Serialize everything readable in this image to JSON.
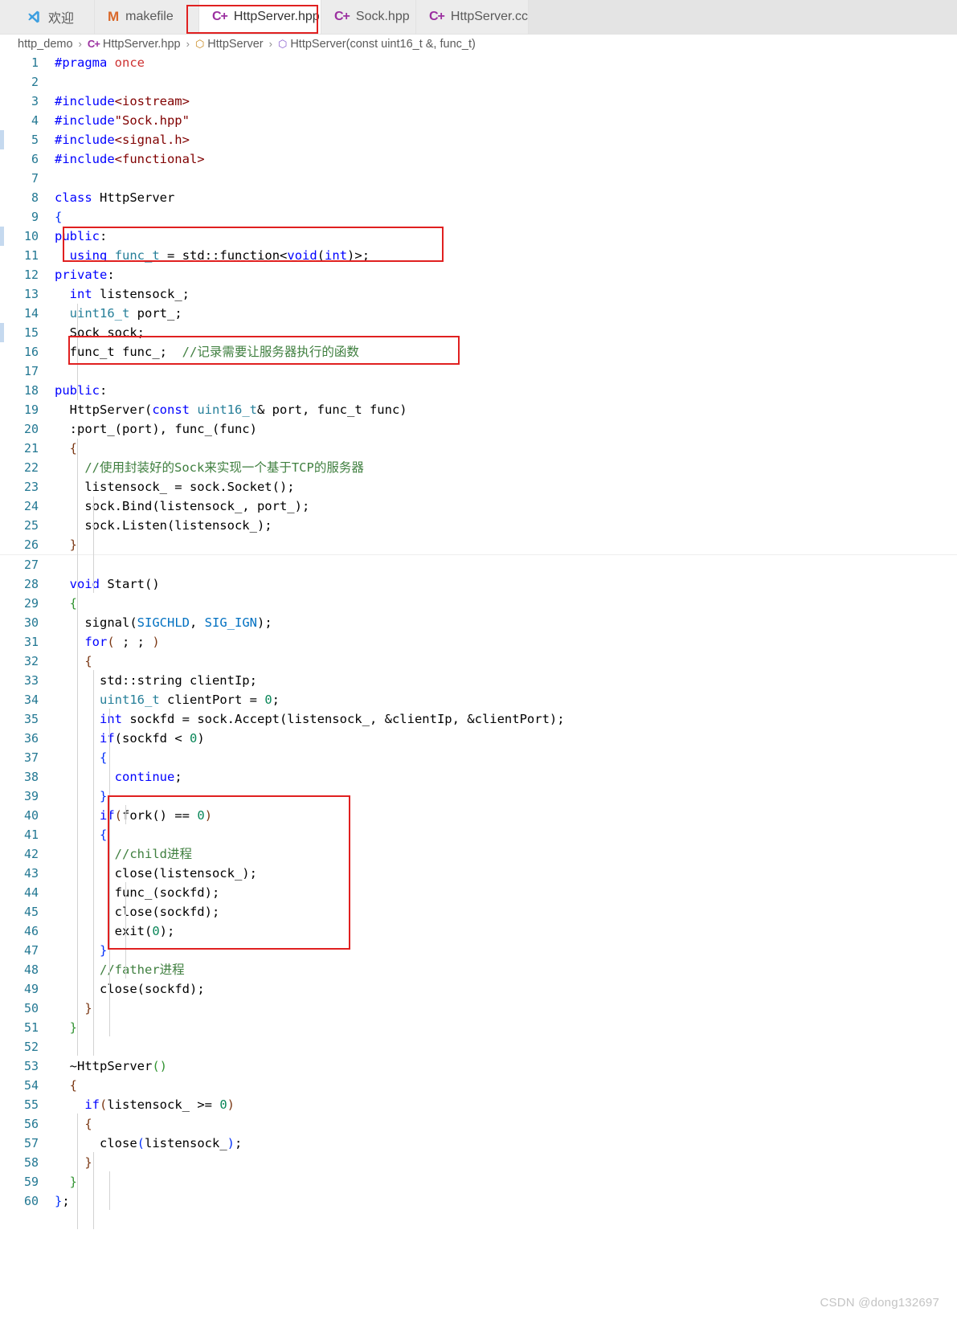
{
  "window": {
    "app": "Visual Studio Code",
    "active_file": "HttpServer.hpp"
  },
  "tabs": [
    {
      "label": "欢迎",
      "icon": "vscode-logo-icon",
      "active": false,
      "closable": false
    },
    {
      "label": "makefile",
      "icon": "makefile-icon",
      "active": false,
      "closable": false
    },
    {
      "label": "HttpServer.hpp",
      "icon": "cpp-file-icon",
      "active": true,
      "closable": true,
      "close_label": "✕"
    },
    {
      "label": "Sock.hpp",
      "icon": "cpp-file-icon",
      "active": false,
      "closable": false
    },
    {
      "label": "HttpServer.cc",
      "icon": "cpp-file-icon",
      "active": false,
      "closable": false
    }
  ],
  "breadcrumb": {
    "separator": "›",
    "items": [
      {
        "label": "http_demo",
        "icon": ""
      },
      {
        "label": "HttpServer.hpp",
        "icon": "cpp-file-icon"
      },
      {
        "label": "HttpServer",
        "icon": "class-icon"
      },
      {
        "label": "HttpServer(const uint16_t &, func_t)",
        "icon": "method-icon"
      }
    ]
  },
  "editor": {
    "language": "cpp",
    "first_line": 1,
    "last_line": 60,
    "lines": [
      {
        "n": 1,
        "text": "#pragma once"
      },
      {
        "n": 2,
        "text": ""
      },
      {
        "n": 3,
        "text": "#include<iostream>"
      },
      {
        "n": 4,
        "text": "#include\"Sock.hpp\""
      },
      {
        "n": 5,
        "text": "#include<signal.h>"
      },
      {
        "n": 6,
        "text": "#include<functional>"
      },
      {
        "n": 7,
        "text": ""
      },
      {
        "n": 8,
        "text": "class HttpServer"
      },
      {
        "n": 9,
        "text": "{"
      },
      {
        "n": 10,
        "text": "public:"
      },
      {
        "n": 11,
        "text": "  using func_t = std::function<void(int)>;"
      },
      {
        "n": 12,
        "text": "private:"
      },
      {
        "n": 13,
        "text": "  int listensock_;"
      },
      {
        "n": 14,
        "text": "  uint16_t port_;"
      },
      {
        "n": 15,
        "text": "  Sock sock;"
      },
      {
        "n": 16,
        "text": "  func_t func_;  //记录需要让服务器执行的函数"
      },
      {
        "n": 17,
        "text": ""
      },
      {
        "n": 18,
        "text": "public:"
      },
      {
        "n": 19,
        "text": "  HttpServer(const uint16_t& port, func_t func)"
      },
      {
        "n": 20,
        "text": "  :port_(port), func_(func)"
      },
      {
        "n": 21,
        "text": "  {"
      },
      {
        "n": 22,
        "text": "    //使用封装好的Sock来实现一个基于TCP的服务器"
      },
      {
        "n": 23,
        "text": "    listensock_ = sock.Socket();"
      },
      {
        "n": 24,
        "text": "    sock.Bind(listensock_, port_);"
      },
      {
        "n": 25,
        "text": "    sock.Listen(listensock_);"
      },
      {
        "n": 26,
        "text": "  }"
      },
      {
        "n": 27,
        "text": ""
      },
      {
        "n": 28,
        "text": "  void Start()"
      },
      {
        "n": 29,
        "text": "  {"
      },
      {
        "n": 30,
        "text": "    signal(SIGCHLD, SIG_IGN);"
      },
      {
        "n": 31,
        "text": "    for( ; ; )"
      },
      {
        "n": 32,
        "text": "    {"
      },
      {
        "n": 33,
        "text": "      std::string clientIp;"
      },
      {
        "n": 34,
        "text": "      uint16_t clientPort = 0;"
      },
      {
        "n": 35,
        "text": "      int sockfd = sock.Accept(listensock_, &clientIp, &clientPort);"
      },
      {
        "n": 36,
        "text": "      if(sockfd < 0)"
      },
      {
        "n": 37,
        "text": "      {"
      },
      {
        "n": 38,
        "text": "        continue;"
      },
      {
        "n": 39,
        "text": "      }"
      },
      {
        "n": 40,
        "text": "      if(fork() == 0)"
      },
      {
        "n": 41,
        "text": "      {"
      },
      {
        "n": 42,
        "text": "        //child进程"
      },
      {
        "n": 43,
        "text": "        close(listensock_);"
      },
      {
        "n": 44,
        "text": "        func_(sockfd);"
      },
      {
        "n": 45,
        "text": "        close(sockfd);"
      },
      {
        "n": 46,
        "text": "        exit(0);"
      },
      {
        "n": 47,
        "text": "      }"
      },
      {
        "n": 48,
        "text": "      //father进程"
      },
      {
        "n": 49,
        "text": "      close(sockfd);"
      },
      {
        "n": 50,
        "text": "    }"
      },
      {
        "n": 51,
        "text": "  }"
      },
      {
        "n": 52,
        "text": ""
      },
      {
        "n": 53,
        "text": "  ~HttpServer()"
      },
      {
        "n": 54,
        "text": "  {"
      },
      {
        "n": 55,
        "text": "    if(listensock_ >= 0)"
      },
      {
        "n": 56,
        "text": "    {"
      },
      {
        "n": 57,
        "text": "      close(listensock_);"
      },
      {
        "n": 58,
        "text": "    }"
      },
      {
        "n": 59,
        "text": "  }"
      },
      {
        "n": 60,
        "text": "};"
      }
    ]
  },
  "annotations": {
    "color": "#e02020",
    "boxes": [
      {
        "name": "tab-highlight-box",
        "covers": "HttpServer.hpp tab"
      },
      {
        "name": "func-t-alias-box",
        "covers": "lines 10-11"
      },
      {
        "name": "func-member-box",
        "covers": "line 16"
      },
      {
        "name": "fork-child-block-box",
        "covers": "lines 40-47"
      }
    ]
  },
  "watermark": {
    "text": "CSDN @dong132697"
  }
}
